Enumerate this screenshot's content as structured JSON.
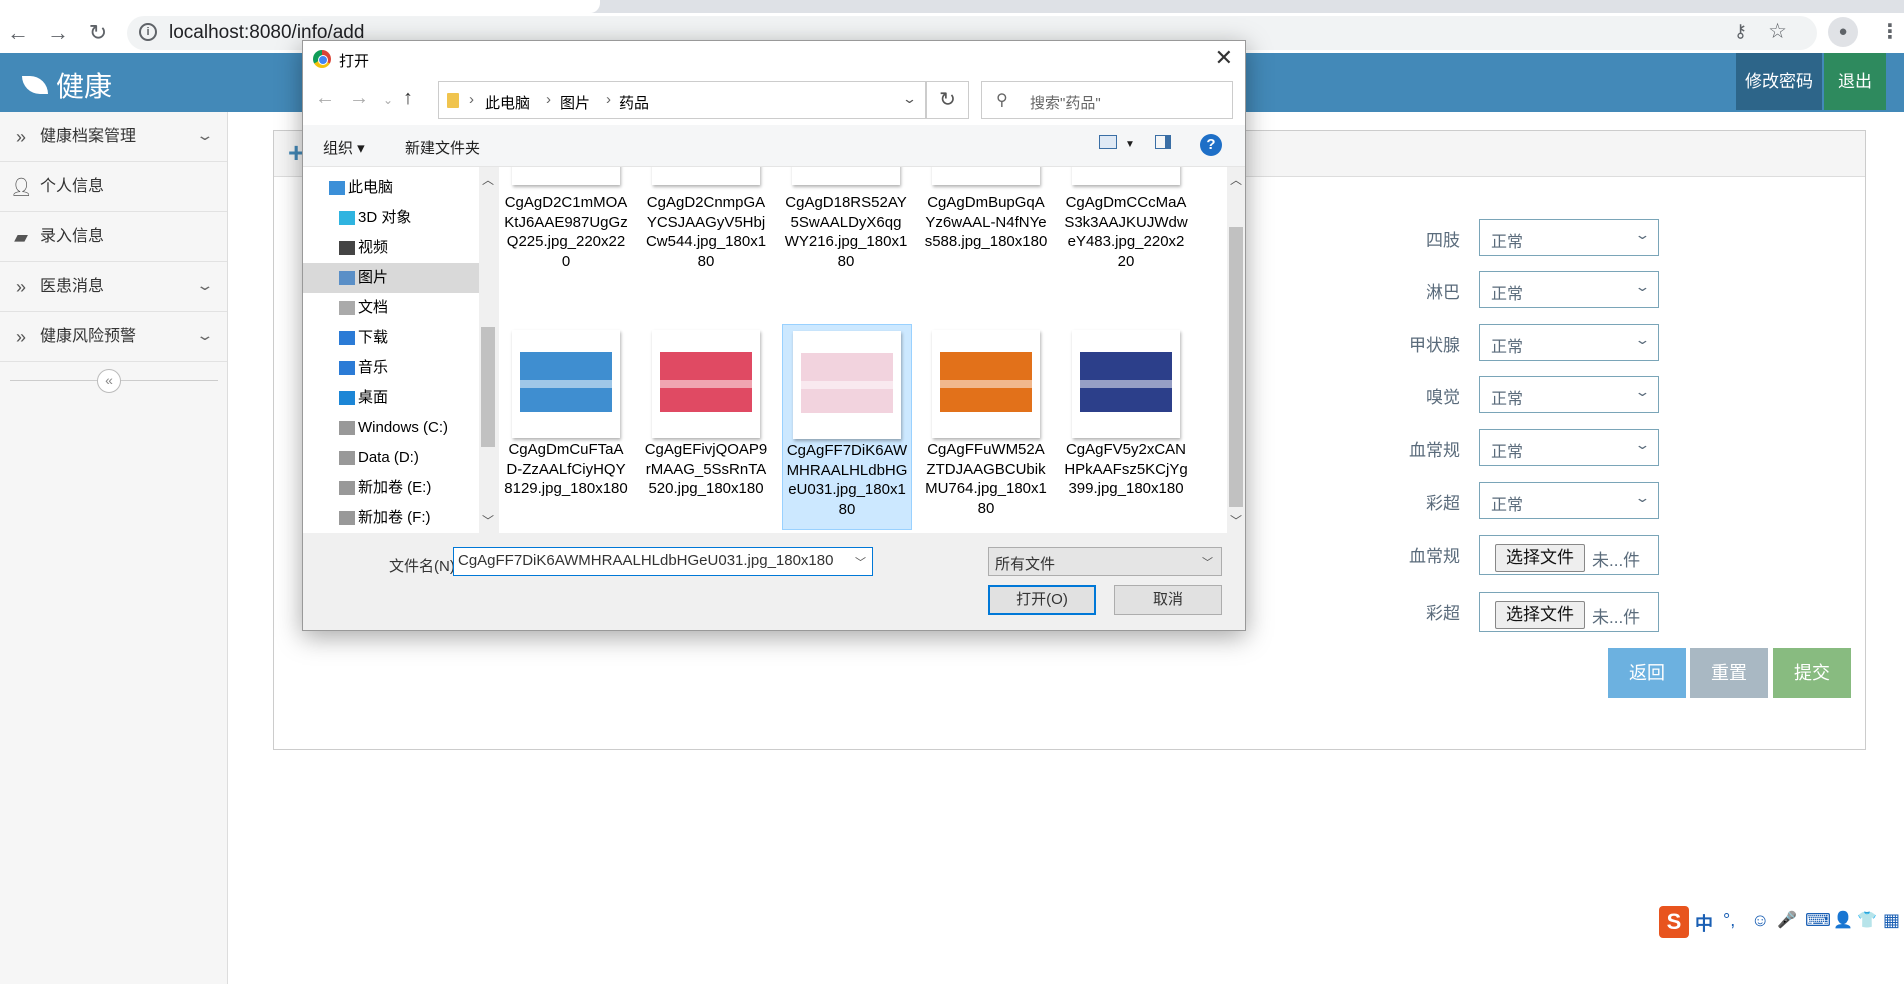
{
  "browser": {
    "url": "localhost:8080/info/add"
  },
  "header": {
    "brand": "健康",
    "change_password": "修改密码",
    "logout": "退出",
    "colors": {
      "header": "#4389b8",
      "change_password": "#2d6589",
      "logout": "#2e8a5e"
    }
  },
  "sidebar": {
    "items": [
      {
        "label": "健康档案管理",
        "icon": "double-chevron-right-icon",
        "expandable": true
      },
      {
        "label": "个人信息",
        "icon": "user-icon",
        "expandable": false
      },
      {
        "label": "录入信息",
        "icon": "book-icon",
        "expandable": false
      },
      {
        "label": "医患消息",
        "icon": "double-chevron-right-icon",
        "expandable": true
      },
      {
        "label": "健康风险预警",
        "icon": "double-chevron-right-icon",
        "expandable": true
      }
    ]
  },
  "form": {
    "selects": [
      {
        "label": "四肢",
        "value": "正常"
      },
      {
        "label": "淋巴",
        "value": "正常"
      },
      {
        "label": "甲状腺",
        "value": "正常"
      },
      {
        "label": "嗅觉",
        "value": "正常"
      },
      {
        "label": "血常规",
        "value": "正常"
      },
      {
        "label": "彩超",
        "value": "正常"
      }
    ],
    "files": [
      {
        "label": "血常规",
        "button": "选择文件",
        "status": "未...件"
      },
      {
        "label": "彩超",
        "button": "选择文件",
        "status": "未...件"
      }
    ],
    "buttons": {
      "back": "返回",
      "reset": "重置",
      "submit": "提交"
    }
  },
  "dialog": {
    "title": "打开",
    "path": [
      "此电脑",
      "图片",
      "药品"
    ],
    "search_placeholder": "搜索\"药品\"",
    "organize": "组织 ▾",
    "new_folder": "新建文件夹",
    "nav": [
      {
        "label": "此电脑",
        "icon": "computer-icon"
      },
      {
        "label": "3D 对象",
        "icon": "3d-objects-icon"
      },
      {
        "label": "视频",
        "icon": "video-icon"
      },
      {
        "label": "图片",
        "icon": "pictures-icon",
        "selected": true
      },
      {
        "label": "文档",
        "icon": "documents-icon"
      },
      {
        "label": "下载",
        "icon": "download-icon"
      },
      {
        "label": "音乐",
        "icon": "music-icon"
      },
      {
        "label": "桌面",
        "icon": "desktop-icon"
      },
      {
        "label": "Windows (C:)",
        "icon": "drive-icon"
      },
      {
        "label": "Data (D:)",
        "icon": "drive-icon"
      },
      {
        "label": "新加卷 (E:)",
        "icon": "drive-icon"
      },
      {
        "label": "新加卷 (F:)",
        "icon": "drive-icon"
      }
    ],
    "files": [
      {
        "name": "CgAgD2C1mMOAKtJ6AAE987UgGzQ225.jpg_220x220",
        "color": "#e8c343"
      },
      {
        "name": "CgAgD2CnmpGAYCSJAAGyV5HbjCw544.jpg_180x180",
        "color": "#cfd8e0"
      },
      {
        "name": "CgAgD18RS52AY5SwAALDyX6qgWY216.jpg_180x180",
        "color": "#e4e6e8"
      },
      {
        "name": "CgAgDmBupGqAYz6wAAL-N4fNYes588.jpg_180x180",
        "color": "#2f9a4a"
      },
      {
        "name": "CgAgDmCCcMaAS3k3AAJKUJWdweY483.jpg_220x220",
        "color": "#3a2e22"
      },
      {
        "name": "CgAgDmCuFTaAD-ZzAALfCiyHQY8129.jpg_180x180",
        "color": "#3f8ed0"
      },
      {
        "name": "CgAgEFivjQOAP9rMAAG_5SsRnTA520.jpg_180x180",
        "color": "#e04a63"
      },
      {
        "name": "CgAgFF7DiK6AWMHRAALHLdbHGeU031.jpg_180x180",
        "color": "#f2d3de",
        "selected": true
      },
      {
        "name": "CgAgFFuWM52AZTDJAAGBCUbikMU764.jpg_180x180",
        "color": "#e2711a"
      },
      {
        "name": "CgAgFV5y2xCANHPkAAFsz5KCjYg399.jpg_180x180",
        "color": "#2c3f8a"
      }
    ],
    "filename_label": "文件名(N):",
    "filename_value": "CgAgFF7DiK6AWMHRAALHLdbHGeU031.jpg_180x180",
    "filetype": "所有文件",
    "open": "打开(O)",
    "cancel": "取消"
  },
  "ime": {
    "logo": "S",
    "items": [
      "中",
      "°,",
      "☺",
      "🎤",
      "⌨",
      "👤",
      "👕",
      "▦"
    ]
  }
}
